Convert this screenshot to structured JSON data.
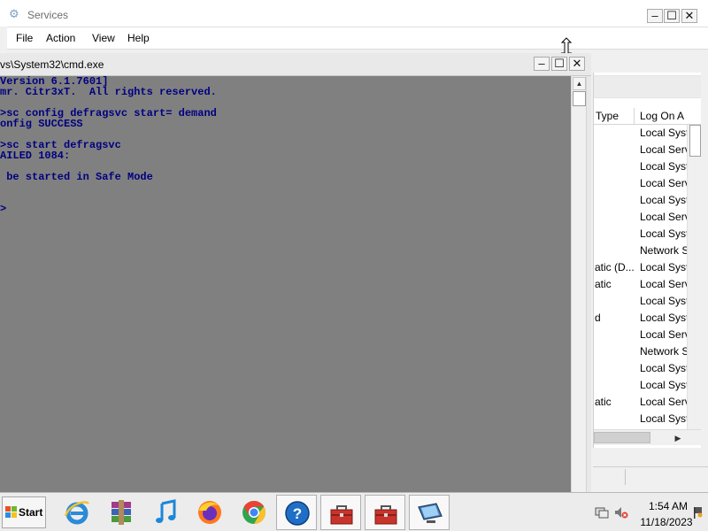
{
  "services_window": {
    "title": "Services",
    "controls": {
      "minimize": "–",
      "maximize": "☐",
      "close": "✕"
    },
    "menu": [
      "File",
      "Action",
      "View",
      "Help"
    ],
    "columns": {
      "type": "Type",
      "logon": "Log On A"
    },
    "rows": [
      {
        "type": "",
        "logon": "Local Syst"
      },
      {
        "type": "",
        "logon": "Local Serv"
      },
      {
        "type": "",
        "logon": "Local Syst"
      },
      {
        "type": "",
        "logon": "Local Serv"
      },
      {
        "type": "",
        "logon": "Local Syst"
      },
      {
        "type": "",
        "logon": "Local Serv"
      },
      {
        "type": "",
        "logon": "Local Syst"
      },
      {
        "type": "",
        "logon": "Network S"
      },
      {
        "type": "atic (D...",
        "logon": "Local Syst"
      },
      {
        "type": "atic",
        "logon": "Local Serv"
      },
      {
        "type": "",
        "logon": "Local Syst"
      },
      {
        "type": "d",
        "logon": "Local Syst"
      },
      {
        "type": "",
        "logon": "Local Serv"
      },
      {
        "type": "",
        "logon": "Network S"
      },
      {
        "type": "",
        "logon": "Local Syst"
      },
      {
        "type": "",
        "logon": "Local Syst"
      },
      {
        "type": "atic",
        "logon": "Local Serv"
      },
      {
        "type": "",
        "logon": "Local Syst"
      }
    ],
    "scroll_right_arrow": "▶"
  },
  "cmd_window": {
    "title": "vs\\System32\\cmd.exe",
    "controls": {
      "minimize": "–",
      "maximize": "☐",
      "close": "✕"
    },
    "scroll_up_arrow": "▲",
    "lines": [
      "Version 6.1.7601]",
      "mr. Citr3xT.  All rights reserved.",
      "",
      ">sc config defragsvc start= demand",
      "onfig SUCCESS",
      "",
      ">sc start defragsvc",
      "AILED 1084:",
      "",
      " be started in Safe Mode",
      "",
      "",
      ">"
    ]
  },
  "taskbar": {
    "start_label": "Start",
    "pinned": [
      {
        "name": "internet-explorer-icon",
        "active": false
      },
      {
        "name": "winrar-icon",
        "active": false
      },
      {
        "name": "itunes-icon",
        "active": false
      },
      {
        "name": "firefox-icon",
        "active": false
      },
      {
        "name": "chrome-icon",
        "active": false
      },
      {
        "name": "help-icon",
        "active": true
      },
      {
        "name": "toolbox-icon",
        "active": true
      },
      {
        "name": "toolbox-icon",
        "active": true
      },
      {
        "name": "monitor-icon",
        "active": true
      }
    ],
    "clock": {
      "time": "1:54 AM",
      "date": "11/18/2023"
    },
    "tray_icons": [
      "network-icon",
      "volume-muted-icon",
      "action-center-flag-icon"
    ]
  },
  "colors": {
    "console_background": "#808080",
    "console_text": "#000080",
    "window_chrome": "#f0f0f0"
  }
}
